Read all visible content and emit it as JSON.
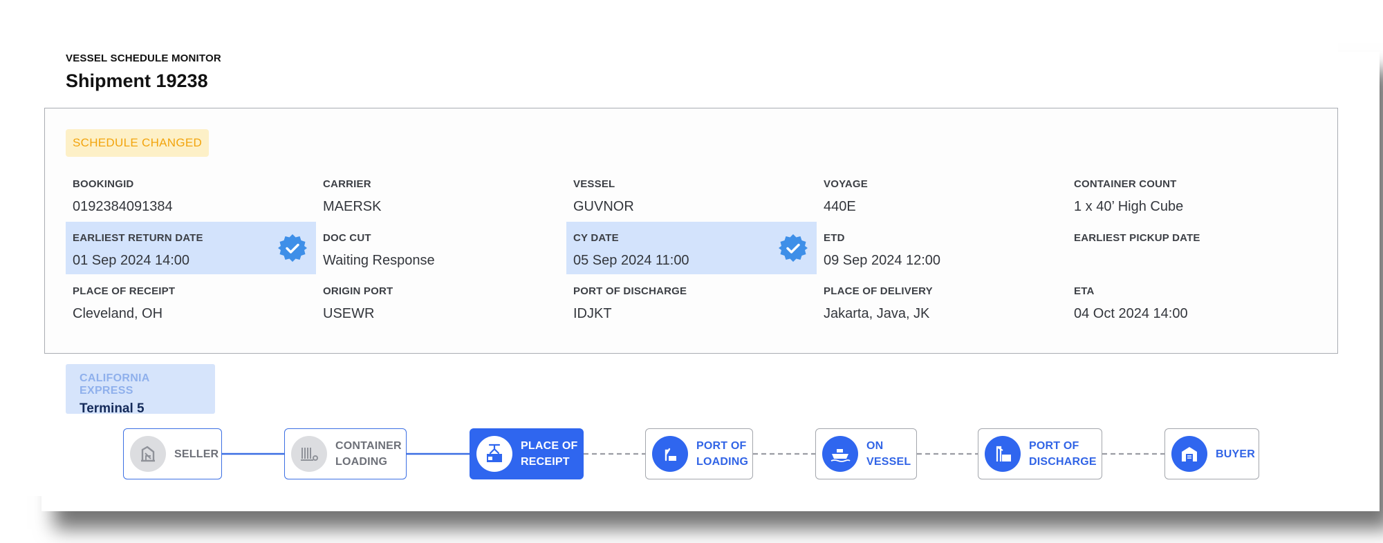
{
  "header": {
    "eyebrow": "VESSEL SCHEDULE MONITOR",
    "title": "Shipment 19238"
  },
  "status_badge": "SCHEDULE CHANGED",
  "fields": [
    {
      "label": "BOOKINGID",
      "value": "0192384091384",
      "verified": false
    },
    {
      "label": "CARRIER",
      "value": "MAERSK",
      "verified": false
    },
    {
      "label": "VESSEL",
      "value": "GUVNOR",
      "verified": false
    },
    {
      "label": "VOYAGE",
      "value": "440E",
      "verified": false
    },
    {
      "label": "CONTAINER COUNT",
      "value": "1 x 40’ High Cube",
      "verified": false
    },
    {
      "label": "EARLIEST RETURN DATE",
      "value": "01 Sep 2024 14:00",
      "verified": true
    },
    {
      "label": "DOC CUT",
      "value": "Waiting Response",
      "verified": false
    },
    {
      "label": "CY DATE",
      "value": "05 Sep 2024 11:00",
      "verified": true
    },
    {
      "label": "ETD",
      "value": "09 Sep 2024 12:00",
      "verified": false
    },
    {
      "label": "EARLIEST PICKUP DATE",
      "value": "",
      "verified": false
    },
    {
      "label": "PLACE OF RECEIPT",
      "value": "Cleveland, OH",
      "verified": false
    },
    {
      "label": "ORIGIN PORT",
      "value": "USEWR",
      "verified": false
    },
    {
      "label": "PORT OF DISCHARGE",
      "value": "IDJKT",
      "verified": false
    },
    {
      "label": "PLACE OF DELIVERY",
      "value": "Jakarta, Java, JK",
      "verified": false
    },
    {
      "label": "ETA",
      "value": "04 Oct 2024 14:00",
      "verified": false
    }
  ],
  "terminal": {
    "name": "CALIFORNIA EXPRESS",
    "sub": "Terminal 5"
  },
  "timeline": [
    {
      "label": "SELLER",
      "state": "done",
      "icon": "seller-icon"
    },
    {
      "label": "CONTAINER\nLOADING",
      "state": "done",
      "icon": "container-loading-icon"
    },
    {
      "label": "PLACE OF\nRECEIPT",
      "state": "current",
      "icon": "crane-container-icon"
    },
    {
      "label": "PORT OF\nLOADING",
      "state": "upcoming",
      "icon": "port-loading-icon"
    },
    {
      "label": "ON\nVESSEL",
      "state": "upcoming",
      "icon": "ship-icon"
    },
    {
      "label": "PORT OF\nDISCHARGE",
      "state": "upcoming",
      "icon": "port-discharge-icon"
    },
    {
      "label": "BUYER",
      "state": "upcoming",
      "icon": "warehouse-icon"
    }
  ],
  "colors": {
    "accent": "#2f66ef",
    "verified_bg": "#d3e3fc",
    "verified_badge": "#3e8fe8",
    "warning_bg": "#fdf0c7",
    "warning_text": "#f2a40d"
  }
}
